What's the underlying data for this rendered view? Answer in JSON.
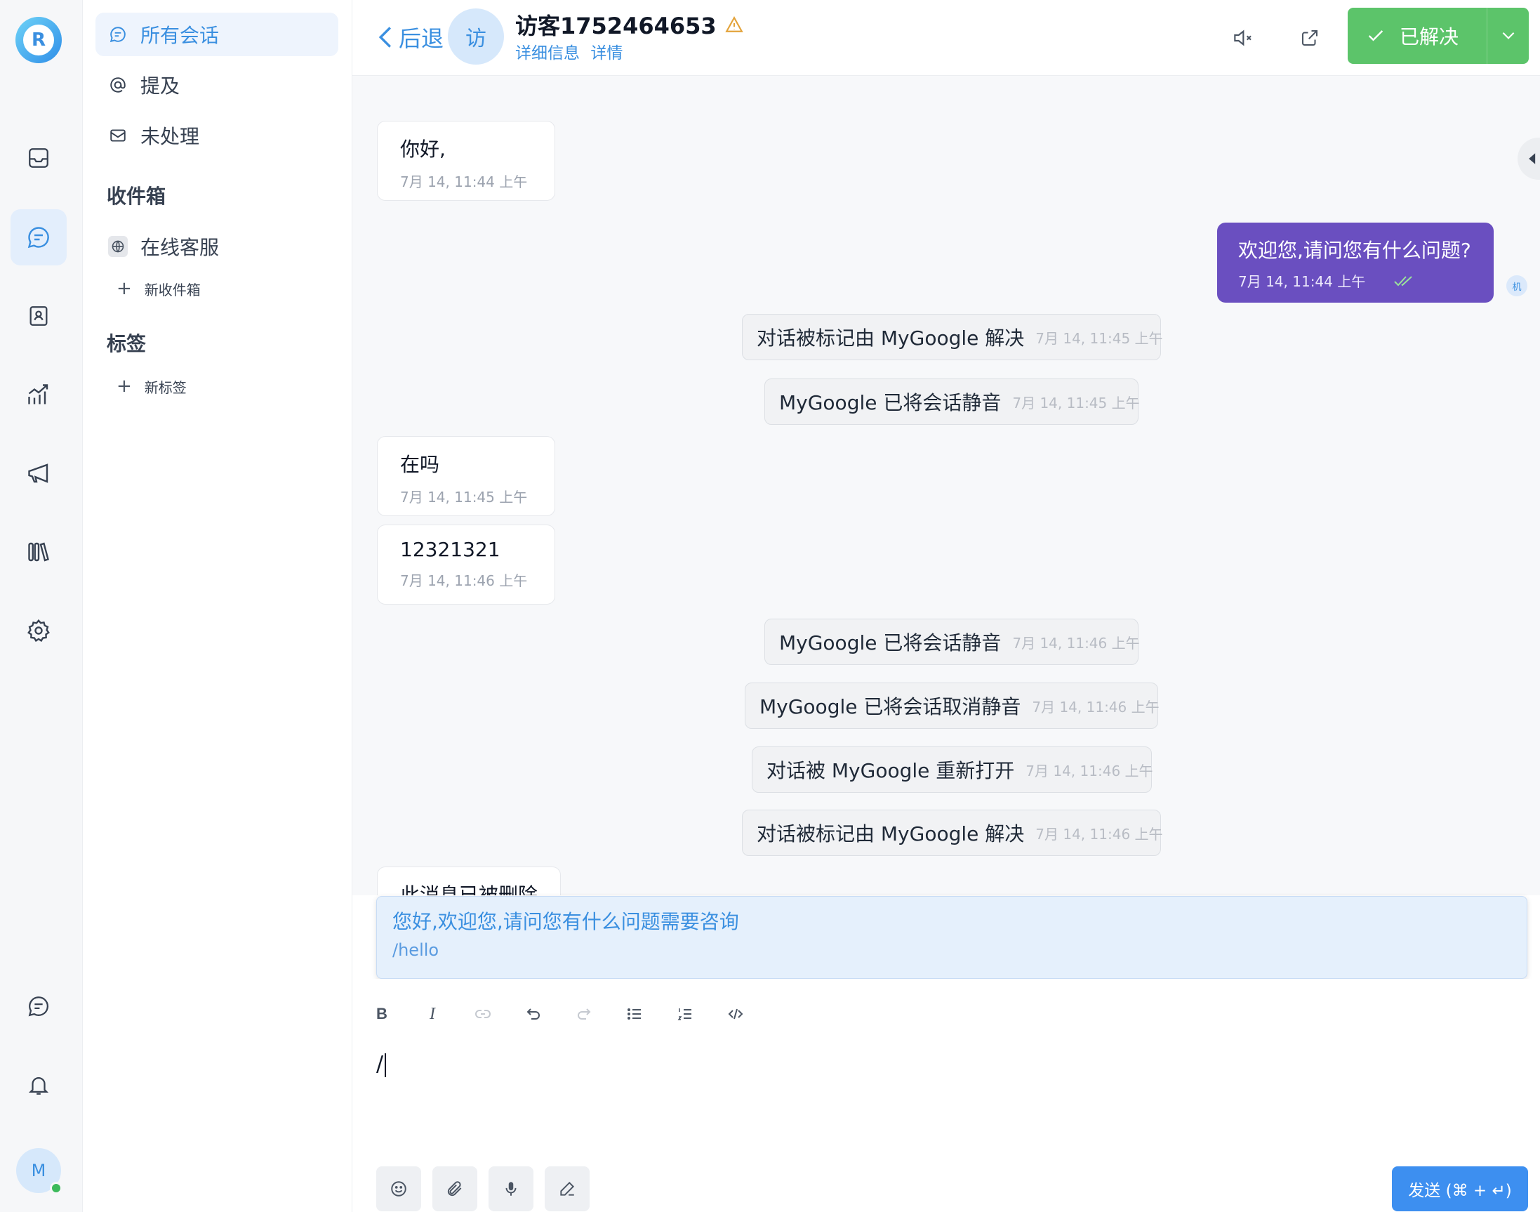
{
  "app": {
    "logo_letter": "R",
    "user_initial": "M"
  },
  "sidebar": {
    "items": [
      {
        "label": "所有会话",
        "icon": "chat-bubble-icon"
      },
      {
        "label": "提及",
        "icon": "at-icon"
      },
      {
        "label": "未处理",
        "icon": "mail-open-icon"
      }
    ],
    "inbox_heading": "收件箱",
    "inboxes": [
      {
        "label": "在线客服",
        "icon": "globe-icon"
      }
    ],
    "new_inbox": "新收件箱",
    "labels_heading": "标签",
    "new_label": "新标签"
  },
  "header": {
    "back_label": "后退",
    "avatar_text": "访",
    "visitor_name": "访客1752464653",
    "detail_link": "详细信息",
    "details_link": "详情",
    "resolve_label": "已解决"
  },
  "messages": {
    "incoming": [
      {
        "text": "你好,",
        "time": "7月 14, 11:44 上午"
      },
      {
        "text": "在吗",
        "time": "7月 14, 11:45 上午"
      },
      {
        "text": "12321321",
        "time": "7月 14, 11:46 上午"
      },
      {
        "text": "此消息已被删除"
      }
    ],
    "outgoing": {
      "text": "欢迎您,请问您有什么问题?",
      "time": "7月 14, 11:44 上午",
      "sender_badge": "机"
    },
    "activities": [
      {
        "text": "对话被标记由 MyGoogle 解决",
        "time": "7月 14, 11:45 上午"
      },
      {
        "text": "MyGoogle 已将会话静音",
        "time": "7月 14, 11:45 上午"
      },
      {
        "text": "MyGoogle 已将会话静音",
        "time": "7月 14, 11:46 上午"
      },
      {
        "text": "MyGoogle 已将会话取消静音",
        "time": "7月 14, 11:46 上午"
      },
      {
        "text": "对话被 MyGoogle 重新打开",
        "time": "7月 14, 11:46 上午"
      },
      {
        "text": "对话被标记由 MyGoogle 解决",
        "time": "7月 14, 11:46 上午"
      }
    ]
  },
  "canned_response": {
    "content": "您好,欢迎您,请问您有什么问题需要咨询",
    "short_code": "/hello"
  },
  "composer": {
    "value": "/",
    "send_label": "发送 (⌘ + ↵)",
    "toolbar": [
      "bold-icon",
      "italic-icon",
      "link-icon",
      "undo-icon",
      "redo-icon",
      "bullet-list-icon",
      "numbered-list-icon",
      "code-icon"
    ]
  },
  "colors": {
    "accent": "#3a8fe0",
    "resolve": "#5cc46a",
    "outgoing_bubble": "#6a4fc0",
    "send": "#3d8ff0"
  }
}
